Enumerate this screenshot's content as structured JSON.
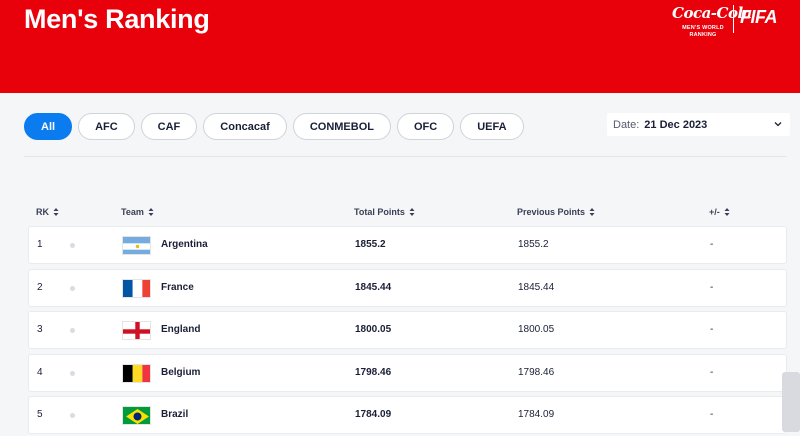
{
  "header": {
    "title": "Men's Ranking",
    "brand_sponsor": "Coca-Cola",
    "brand_sub": "MEN'S WORLD RANKING",
    "brand_fifa": "FIFA"
  },
  "filters": [
    {
      "label": "All",
      "active": true
    },
    {
      "label": "AFC",
      "active": false
    },
    {
      "label": "CAF",
      "active": false
    },
    {
      "label": "Concacaf",
      "active": false
    },
    {
      "label": "CONMEBOL",
      "active": false
    },
    {
      "label": "OFC",
      "active": false
    },
    {
      "label": "UEFA",
      "active": false
    }
  ],
  "date": {
    "label": "Date:",
    "value": "21 Dec 2023"
  },
  "table": {
    "columns": {
      "rank": "RK",
      "team": "Team",
      "total_points": "Total Points",
      "previous_points": "Previous Points",
      "change": "+/-"
    },
    "rows": [
      {
        "rank": "1",
        "team": "Argentina",
        "flag": "argentina-flag",
        "total": "1855.2",
        "previous": "1855.2",
        "change": "-"
      },
      {
        "rank": "2",
        "team": "France",
        "flag": "france-flag",
        "total": "1845.44",
        "previous": "1845.44",
        "change": "-"
      },
      {
        "rank": "3",
        "team": "England",
        "flag": "england-flag",
        "total": "1800.05",
        "previous": "1800.05",
        "change": "-"
      },
      {
        "rank": "4",
        "team": "Belgium",
        "flag": "belgium-flag",
        "total": "1798.46",
        "previous": "1798.46",
        "change": "-"
      },
      {
        "rank": "5",
        "team": "Brazil",
        "flag": "brazil-flag",
        "total": "1784.09",
        "previous": "1784.09",
        "change": "-"
      }
    ]
  },
  "colors": {
    "brand_red": "#e8000b",
    "accent_blue": "#0a7cf0",
    "background": "#f5f6f8"
  }
}
